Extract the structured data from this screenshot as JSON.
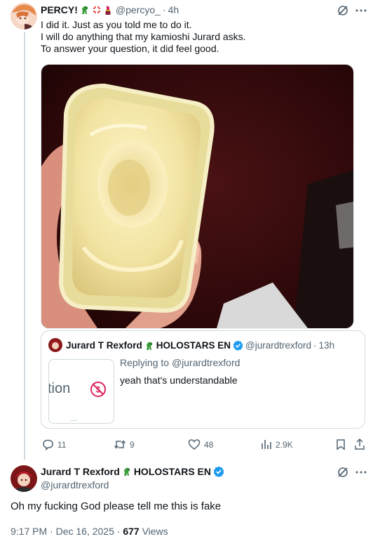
{
  "post": {
    "display_name": "PERCY!",
    "emoji": [
      "dinosaur-emoji",
      "anger-emoji",
      "lipstick-emoji"
    ],
    "handle": "@percyo_",
    "separator": "·",
    "time": "4h",
    "lines": [
      "I did it. Just as you told me to do it.",
      "I will do anything that my kamioshi Jurard asks.",
      "To answer your question, it did feel good."
    ]
  },
  "quoted": {
    "display_name": "Jurard T Rexford",
    "org": "HOLOSTARS EN",
    "handle": "@jurardtrexford",
    "separator": "·",
    "time": "13h",
    "replying_prefix": "Replying to",
    "replying_handle": "@jurardtrexford",
    "text": "yeah that's understandable",
    "thumb_text": "tion"
  },
  "actions": {
    "replies": "11",
    "reposts": "9",
    "likes": "48",
    "views": "2.9K"
  },
  "reply": {
    "display_name": "Jurard T Rexford",
    "org": "HOLOSTARS EN",
    "handle": "@jurardtrexford",
    "text": "Oh my fucking God please tell me this is fake",
    "timestamp": "9:17 PM · Dec 16, 2025",
    "separator": "·",
    "views_count": "677",
    "views_label": "Views"
  },
  "colors": {
    "verified": "#1d9bf0",
    "muted": "#536471",
    "border": "#cfd9de",
    "prohibited": "#e0245e"
  }
}
